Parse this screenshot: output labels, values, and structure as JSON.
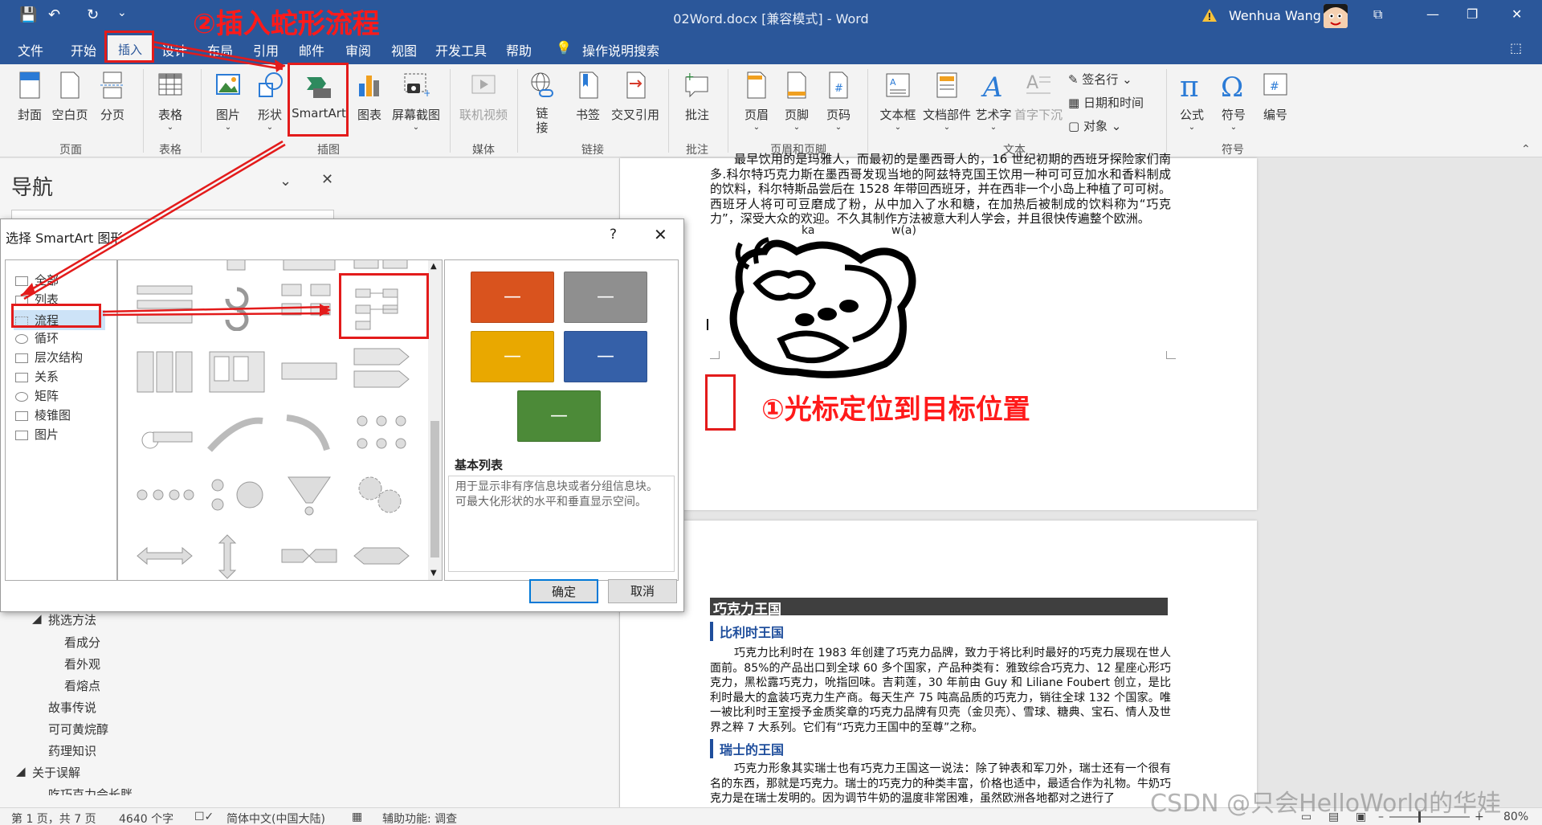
{
  "window": {
    "doc_title": "02Word.docx [兼容模式] - Word",
    "user_name": "Wenhua Wang"
  },
  "quick_access": {
    "save": "💾",
    "undo": "↶",
    "redo": "↻",
    "more": "⌄"
  },
  "menu_tabs": [
    "文件",
    "开始",
    "插入",
    "设计",
    "布局",
    "引用",
    "邮件",
    "审阅",
    "视图",
    "开发工具",
    "帮助"
  ],
  "tell_me": "操作说明搜索",
  "ribbon": {
    "pages": {
      "cover": "封面",
      "blank": "空白页",
      "break": "分页",
      "group": "页面"
    },
    "tables": {
      "table": "表格",
      "group": "表格"
    },
    "illustrations": {
      "picture": "图片",
      "shapes": "形状",
      "smartart": "SmartArt",
      "chart": "图表",
      "screenshot": "屏幕截图",
      "group": "插图"
    },
    "media": {
      "online_video": "联机视频",
      "group": "媒体"
    },
    "links": {
      "link": "链\n接",
      "bookmark": "书签",
      "crossref": "交叉引用",
      "group": "链接"
    },
    "comments": {
      "comment": "批注",
      "group": "批注"
    },
    "header_footer": {
      "header": "页眉",
      "footer": "页脚",
      "page_number": "页码",
      "group": "页眉和页脚"
    },
    "text": {
      "textbox": "文本框",
      "quickparts": "文档部件",
      "wordart": "艺术字",
      "dropcap": "首字下沉",
      "signature": "签名行",
      "datetime": "日期和时间",
      "object": "对象",
      "group": "文本"
    },
    "symbols": {
      "equation": "公式",
      "symbol": "符号",
      "numbering": "编号",
      "group": "符号"
    }
  },
  "nav_pane": {
    "title": "导航",
    "items": [
      {
        "label": "挑选方法",
        "level": 1,
        "arrow": "◢"
      },
      {
        "label": "看成分",
        "level": 2
      },
      {
        "label": "看外观",
        "level": 2
      },
      {
        "label": "看熔点",
        "level": 2
      },
      {
        "label": "故事传说",
        "level": 1
      },
      {
        "label": "可可黄烷醇",
        "level": 1
      },
      {
        "label": "药理知识",
        "level": 1
      },
      {
        "label": "关于误解",
        "level": 0,
        "arrow": "◢"
      },
      {
        "label": "吃巧克力会长胖",
        "level": 1
      }
    ]
  },
  "dialog": {
    "title": "选择 SmartArt 图形",
    "help": "?",
    "close": "✕",
    "categories": [
      "全部",
      "列表",
      "流程",
      "循环",
      "层次结构",
      "关系",
      "矩阵",
      "棱锥图",
      "图片"
    ],
    "selected_category": "流程",
    "preview_name": "基本列表",
    "preview_desc": "用于显示非有序信息块或者分组信息块。可最大化形状的水平和垂直显示空间。",
    "preview_colors": [
      "#d9531e",
      "#8f8f8f",
      "#e9a800",
      "#3560a8",
      "#4c8a38"
    ],
    "ok": "确定",
    "cancel": "取消"
  },
  "document": {
    "page1_paragraph": "最早饮用的是玛雅人，而最初的是墨西哥人的，16 世纪初期的西班牙探险家们南多.科尔特巧克力斯在墨西哥发现当地的阿兹特克国王饮用一种可可豆加水和香料制成的饮料，科尔特斯品尝后在 1528 年带回西班牙，并在西非一个小岛上种植了可可树。西班牙人将可可豆磨成了粉，从中加入了水和糖，在加热后被制成的饮料称为“巧克力”，深受大众的欢迎。不久其制作方法被意大利人学会，并且很快传遍整个欧洲。",
    "formula_left": "ka",
    "formula_right": "w(a)",
    "heading_kingdom": "巧克力王国",
    "heading_belgium": "比利时王国",
    "belgium_text": "巧克力比利时在 1983 年创建了巧克力品牌，致力于将比利时最好的巧克力展现在世人面前。85%的产品出口到全球 60 多个国家，产品种类有：雅致综合巧克力、12 星座心形巧克力，黑松露巧克力，吮指回味。吉莉莲，30 年前由 Guy 和 Liliane Foubert 创立，是比利时最大的盒装巧克力生产商。每天生产 75 吨高品质的巧克力，销往全球 132 个国家。唯一被比利时王室授予金质奖章的巧克力品牌有贝壳（金贝壳）、雪球、糖典、宝石、情人及世界之粹 7 大系列。它们有“巧克力王国中的至尊”之称。",
    "heading_swiss": "瑞士的王国",
    "swiss_text": "巧克力形象其实瑞士也有巧克力王国这一说法：除了钟表和军刀外，瑞士还有一个很有名的东西，那就是巧克力。瑞士的巧克力的种类丰富，价格也适中，最适合作为礼物。牛奶巧克力是在瑞士发明的。因为调节牛奶的温度非常困难，虽然欧洲各地都对之进行了"
  },
  "annotations": {
    "step2": "②插入蛇形流程",
    "step1": "①光标定位到目标位置"
  },
  "status": {
    "page": "第 1 页，共 7 页",
    "words": "4640 个字",
    "language": "简体中文(中国大陆)",
    "accessibility": "辅助功能: 调查",
    "zoom": "80%"
  },
  "watermark": "CSDN @只会HelloWorld的华娃"
}
